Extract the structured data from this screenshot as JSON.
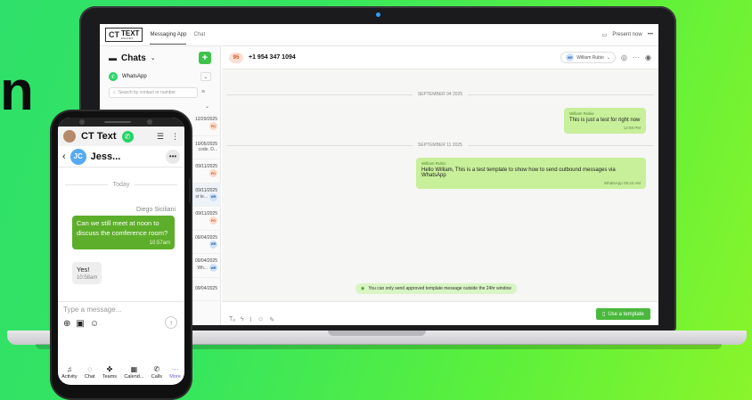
{
  "hero_text": "n",
  "desktop": {
    "logo": {
      "ct": "CT",
      "text_line1": "TEXT",
      "text_line2": "ENGINES"
    },
    "tabs": [
      {
        "label": "Messaging App"
      },
      {
        "label": "Chat"
      }
    ],
    "present_label": "Present now",
    "sidebar": {
      "title": "Chats",
      "channel": "WhatsApp",
      "search_placeholder": "Search by contact or number",
      "conversations": [
        {
          "date": "12/29/2025",
          "snippet": "",
          "avatar": "PO"
        },
        {
          "date": "10/05/2025",
          "snippet": "code. D...",
          "avatar": ""
        },
        {
          "date": "09/11/2025",
          "snippet": "",
          "avatar": "PO"
        },
        {
          "date": "09/11/2025",
          "snippet": "st te...",
          "avatar": "WR"
        },
        {
          "date": "09/11/2025",
          "snippet": "",
          "avatar": "PO"
        },
        {
          "date": "09/04/2025",
          "snippet": "",
          "avatar": "WR"
        },
        {
          "date": "09/04/2025",
          "snippet": "Wh...",
          "avatar": "WR"
        },
        {
          "date": "09/04/2025",
          "snippet": "",
          "avatar": ""
        }
      ]
    },
    "chat": {
      "avatar": "95",
      "phone": "+1 954 347 1094",
      "assignee_initials": "WR",
      "assignee": "William Rubio",
      "sep1": "SEPTEMBER 04 2025",
      "msg1": {
        "sender": "William Rubio",
        "text": "This is just a test for right now",
        "time": "12:59 PM"
      },
      "sep2": "SEPTEMBER 11 2025",
      "msg2": {
        "sender": "William Rubio",
        "text": "Hello William, This is a test template to show how to send outbound messages via WhatsApp",
        "time": "WhatsApp  09:44 AM"
      },
      "notice": "You can only send approved template message outside the 24hr window",
      "template_button": "Use a template"
    }
  },
  "mobile": {
    "app_title": "CT Text",
    "contact_initials": "JC",
    "contact_name": "Jess...",
    "today": "Today",
    "sender": "Diego Siciliani",
    "out_msg": {
      "text": "Can we still meet at noon to discuss the comference room?",
      "time": "10:57am"
    },
    "in_msg": {
      "text": "Yes!",
      "time": "10:58am"
    },
    "input_placeholder": "Type a message...",
    "nav": [
      {
        "label": "Activity"
      },
      {
        "label": "Chat"
      },
      {
        "label": "Teams"
      },
      {
        "label": "Calend..."
      },
      {
        "label": "Calls"
      },
      {
        "label": "More"
      }
    ]
  },
  "colors": {
    "brand_green": "#4ab83c",
    "bubble_green": "#c8ef9a",
    "mobile_bubble": "#5dae2a",
    "background": "#35e55f"
  }
}
